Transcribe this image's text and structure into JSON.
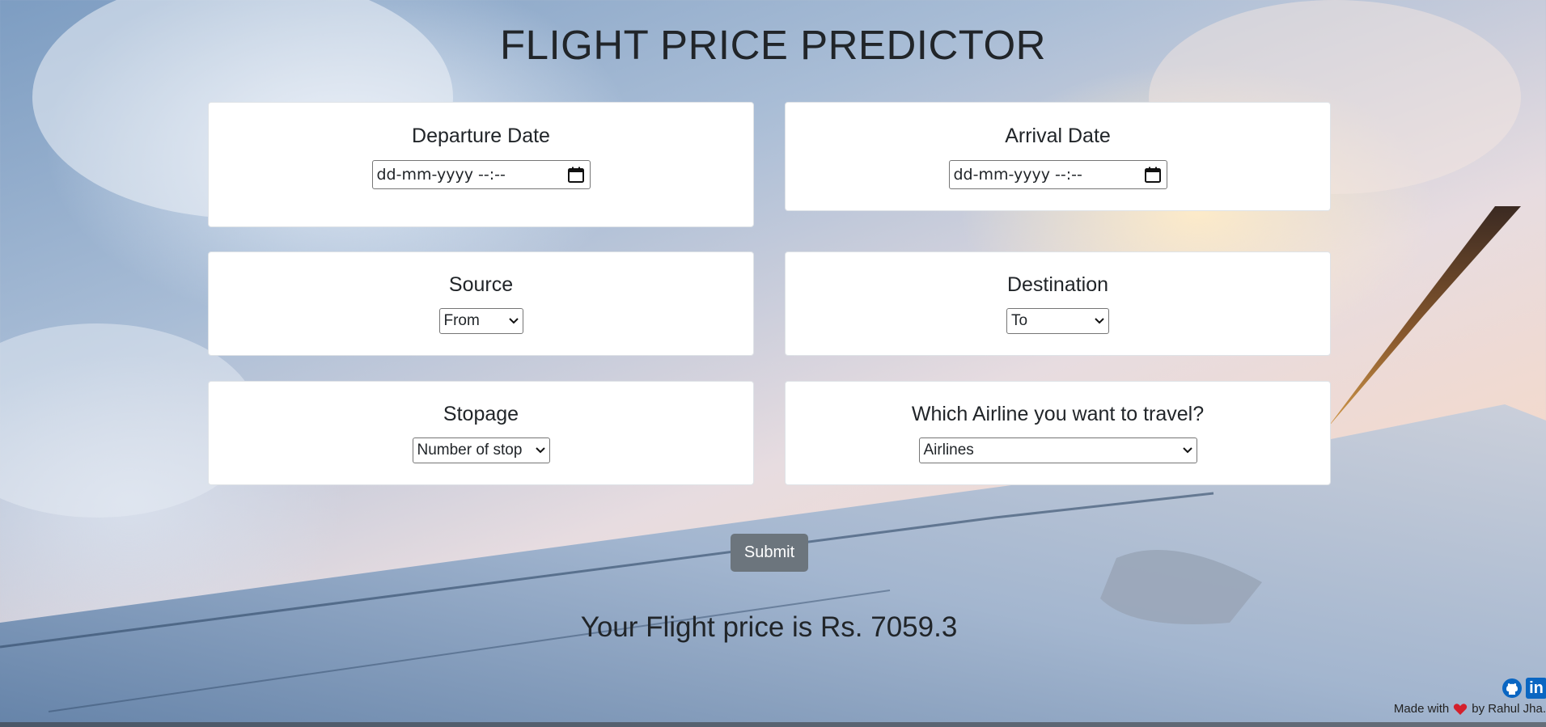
{
  "page": {
    "title": "FLIGHT PRICE PREDICTOR"
  },
  "form": {
    "departure": {
      "label": "Departure Date",
      "value": "dd-mm-yyyy --:--"
    },
    "arrival": {
      "label": "Arrival Date",
      "value": "dd-mm-yyyy --:--"
    },
    "source": {
      "label": "Source",
      "selected": "From"
    },
    "destination": {
      "label": "Destination",
      "selected": "To"
    },
    "stopage": {
      "label": "Stopage",
      "selected": "Number of stop"
    },
    "airline": {
      "label": "Which Airline you want to travel?",
      "selected": "Airlines"
    },
    "submit_label": "Submit"
  },
  "result": {
    "text": "Your Flight price is Rs. 7059.3"
  },
  "footer": {
    "made_with": "Made with",
    "by": "by Rahul Jha.",
    "icons": [
      "github-icon",
      "linkedin-icon",
      "heart-icon"
    ]
  },
  "colors": {
    "button": "#6c757d",
    "heart": "#d4202c",
    "linkedin": "#0a66c2"
  }
}
